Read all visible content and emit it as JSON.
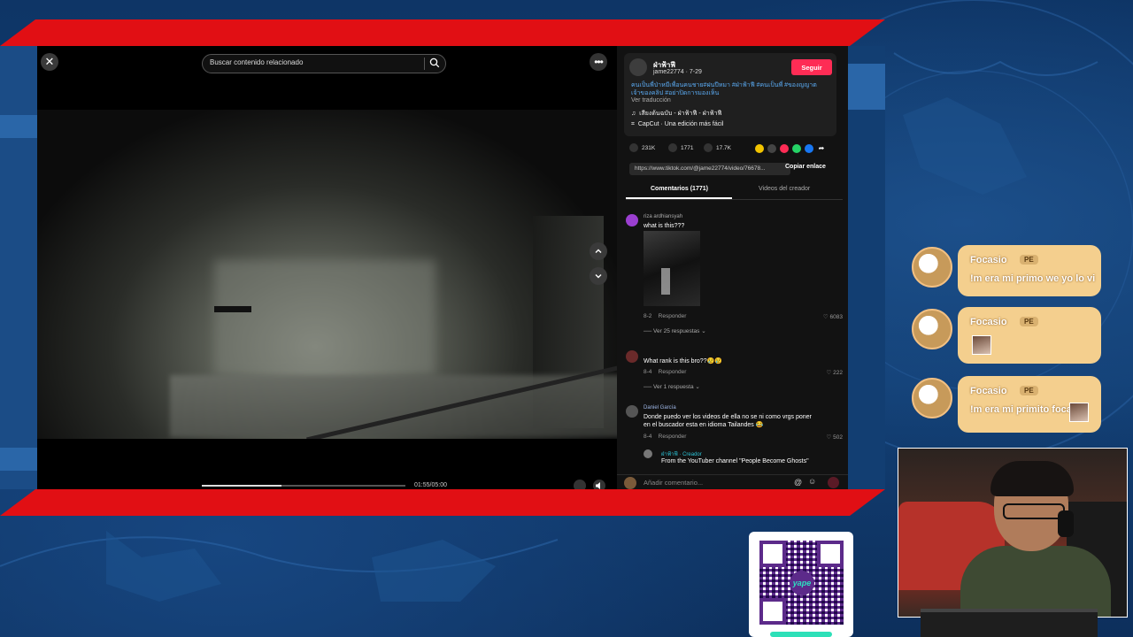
{
  "player": {
    "search_placeholder": "Buscar contenido relacionado",
    "time": "01:55/05:00",
    "progress": 0.39
  },
  "post": {
    "author": "ฝ่าฟ้าฟี",
    "handle_date": "jame22774 · 7-29",
    "follow_label": "Seguir",
    "description": "คนเป็นพี่ป่าหมีเพื่อนคนชาย#ฝนปีหมา #ฝ่าฟ้าฟี #คนเป็นพี่ #ของญญาตเจ้าของคลิป #อย่าปิดการมองเห็น",
    "translate_label": "Ver traducción",
    "music": "เสียงต้นฉบับ - ฝ่าฟ้าฟี - ฝ่าฟ้าฟี",
    "capcut": "CapCut · Una edición más fácil",
    "likes": "231K",
    "comments_count": "1771",
    "saves": "17.7K",
    "link": "https://www.tiktok.com/@jame22774/video/76678...",
    "copy_label": "Copiar enlace",
    "tab_comments": "Comentarios (1771)",
    "tab_creator": "Videos del creador",
    "input_placeholder": "Añadir comentario...",
    "share_colors": [
      "#f2c400",
      "#444444",
      "#fe2c55",
      "#25d366",
      "#1877f2",
      "#121212"
    ]
  },
  "comments": [
    {
      "user": "riza ardhiansyah",
      "text": "what is this???",
      "date": "8-2",
      "reply": "Responder",
      "likes": "6083",
      "more": "Ver 25 respuestas",
      "avatar_color": "#9b3fd0"
    },
    {
      "user": "",
      "text": "What rank is this bro??😢😢",
      "date": "8-4",
      "reply": "Responder",
      "likes": "222",
      "more": "Ver 1 respuesta",
      "avatar_color": "#6a2a2a"
    },
    {
      "user": "Daniel García",
      "text": "Donde puedo ver los videos de ella no se ni como vrgs poner en el buscador esta en idioma Tailandes 😂",
      "date": "8-4",
      "reply": "Responder",
      "likes": "502",
      "avatar_color": "#555555"
    },
    {
      "user": "ฝ่าฟ้าฟี · Creador",
      "text": "From the YouTuber channel \"People Become Ghosts\"",
      "avatar_color": "#777777"
    }
  ],
  "chat": [
    {
      "name": "Focasio",
      "badge": "PE",
      "text": "!m era mi primo we yo lo vi"
    },
    {
      "name": "Focasio",
      "badge": "PE",
      "text": ""
    },
    {
      "name": "Focasio",
      "badge": "PE",
      "text": "!m era mi primito foca"
    }
  ],
  "qr": {
    "brand": "yape"
  }
}
